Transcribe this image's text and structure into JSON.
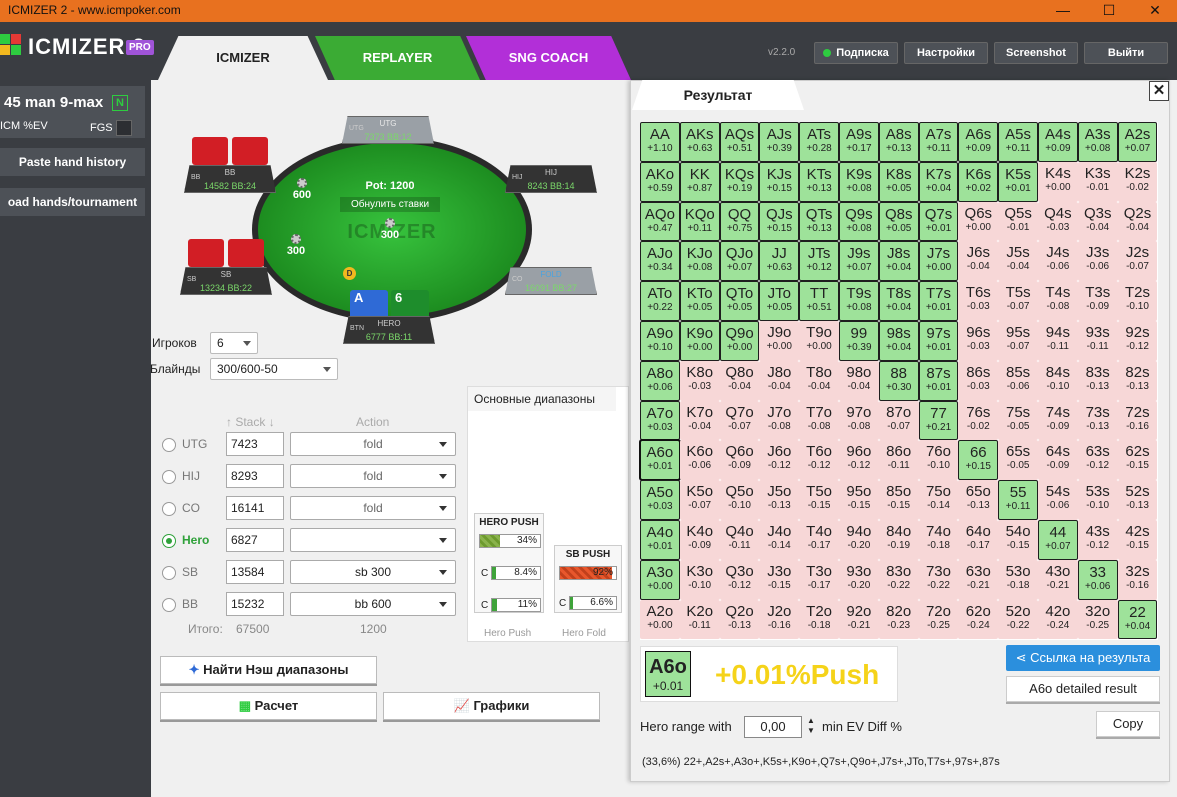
{
  "window": {
    "title": "ICMIZER 2 - www.icmpoker.com",
    "minimize": "—",
    "maximize": "☐",
    "close": "✕"
  },
  "app": {
    "name": "ICMIZER 2",
    "badge": "PRO",
    "version": "v2.2.0"
  },
  "tabs": {
    "icmizer": "ICMIZER",
    "replayer": "REPLAYER",
    "sng": "SNG COACH"
  },
  "top_buttons": {
    "subscription": "Подписка",
    "settings": "Настройки",
    "screenshot": "Screenshot",
    "exit": "Выйти"
  },
  "sidebar": {
    "title": "45 man 9-max",
    "badge": "N",
    "mode": "ICM %EV",
    "fgs": "FGS",
    "paste": "Paste hand history",
    "load": "oad hands/tournament"
  },
  "table": {
    "pot": "Pot: 1200",
    "reset": "Обнулить ставки",
    "watermark": "ICMIZER",
    "dealer": "D",
    "seats": {
      "utg": {
        "pos": "UTG",
        "name": "UTG",
        "stack": "7373 BB:12"
      },
      "hij": {
        "pos": "HIJ",
        "name": "HIJ",
        "stack": "8243 BB:14"
      },
      "co": {
        "pos": "CO",
        "name": "FOLD",
        "stack": "16091 BB:27"
      },
      "bb": {
        "pos": "BB",
        "name": "BB",
        "stack": "14582 BB:24"
      },
      "sb": {
        "pos": "SB",
        "name": "SB",
        "stack": "13234 BB:22"
      },
      "hero": {
        "pos": "BTN",
        "name": "HERO",
        "stack": "6777 BB:11"
      }
    },
    "chips": {
      "bb": "600",
      "sb": "300",
      "btn": "300"
    },
    "hero_cards": [
      "A",
      "6"
    ]
  },
  "settings": {
    "players_label": "Игроков",
    "players": "6",
    "blinds_label": "Блайнды",
    "blinds": "300/600-50"
  },
  "columns": {
    "stack": "Stack",
    "action": "Action"
  },
  "rows": [
    {
      "name": "UTG",
      "stack": "7423",
      "action": "fold"
    },
    {
      "name": "HIJ",
      "stack": "8293",
      "action": "fold"
    },
    {
      "name": "CO",
      "stack": "16141",
      "action": "fold"
    },
    {
      "name": "Hero",
      "stack": "6827",
      "action": ""
    },
    {
      "name": "SB",
      "stack": "13584",
      "action": "sb 300"
    },
    {
      "name": "BB",
      "stack": "15232",
      "action": "bb 600"
    }
  ],
  "totals": {
    "label": "Итого:",
    "stack": "67500",
    "action": "1200"
  },
  "ranges_panel": {
    "tab": "Основные диапазоны",
    "hero_push": {
      "title": "HERO PUSH",
      "pct": "34%",
      "fill": 0.34,
      "c1_label": "C",
      "c1": "8.4%",
      "c1_fill": 0.084,
      "c2_label": "C",
      "c2": "11%",
      "c2_fill": 0.11,
      "footer": "Hero Push"
    },
    "sb_push": {
      "title": "SB PUSH",
      "pct": "92%",
      "fill": 0.92,
      "c1_label": "C",
      "c1": "6.6%",
      "c1_fill": 0.066,
      "footer": "Hero Fold"
    }
  },
  "buttons": {
    "nash": "Найти Нэш диапазоны",
    "calc": "Расчет",
    "graphs": "Графики"
  },
  "result": {
    "tab": "Результат",
    "close": "✕",
    "selected": {
      "hand": "A6o",
      "ev": "+0.01",
      "big": "+0.01%Push"
    },
    "link_button": "Ссылка на результа",
    "detailed_button": "A6o detailed result",
    "copy_button": "Copy",
    "hero_range_label": "Hero range with",
    "hero_range_value": "0,00",
    "hero_range_tail": "min EV Diff %",
    "range_string": "(33,6%) 22+,A2s+,A3o+,K5s+,K9o+,Q7s+,Q9o+,J7s+,JTo,T7s+,97s+,87s"
  },
  "matrix": [
    [
      [
        "AA",
        "+1.10",
        1
      ],
      [
        "AKs",
        "+0.63",
        1
      ],
      [
        "AQs",
        "+0.51",
        1
      ],
      [
        "AJs",
        "+0.39",
        1
      ],
      [
        "ATs",
        "+0.28",
        1
      ],
      [
        "A9s",
        "+0.17",
        1
      ],
      [
        "A8s",
        "+0.13",
        1
      ],
      [
        "A7s",
        "+0.11",
        1
      ],
      [
        "A6s",
        "+0.09",
        1
      ],
      [
        "A5s",
        "+0.11",
        1
      ],
      [
        "A4s",
        "+0.09",
        1
      ],
      [
        "A3s",
        "+0.08",
        1
      ],
      [
        "A2s",
        "+0.07",
        1
      ]
    ],
    [
      [
        "AKo",
        "+0.59",
        1
      ],
      [
        "KK",
        "+0.87",
        1
      ],
      [
        "KQs",
        "+0.19",
        1
      ],
      [
        "KJs",
        "+0.15",
        1
      ],
      [
        "KTs",
        "+0.13",
        1
      ],
      [
        "K9s",
        "+0.08",
        1
      ],
      [
        "K8s",
        "+0.05",
        1
      ],
      [
        "K7s",
        "+0.04",
        1
      ],
      [
        "K6s",
        "+0.02",
        1
      ],
      [
        "K5s",
        "+0.01",
        1
      ],
      [
        "K4s",
        "+0.00",
        0
      ],
      [
        "K3s",
        "-0.01",
        0
      ],
      [
        "K2s",
        "-0.02",
        0
      ]
    ],
    [
      [
        "AQo",
        "+0.47",
        1
      ],
      [
        "KQo",
        "+0.11",
        1
      ],
      [
        "QQ",
        "+0.75",
        1
      ],
      [
        "QJs",
        "+0.15",
        1
      ],
      [
        "QTs",
        "+0.13",
        1
      ],
      [
        "Q9s",
        "+0.08",
        1
      ],
      [
        "Q8s",
        "+0.05",
        1
      ],
      [
        "Q7s",
        "+0.01",
        1
      ],
      [
        "Q6s",
        "+0.00",
        0
      ],
      [
        "Q5s",
        "-0.01",
        0
      ],
      [
        "Q4s",
        "-0.03",
        0
      ],
      [
        "Q3s",
        "-0.04",
        0
      ],
      [
        "Q2s",
        "-0.04",
        0
      ]
    ],
    [
      [
        "AJo",
        "+0.34",
        1
      ],
      [
        "KJo",
        "+0.08",
        1
      ],
      [
        "QJo",
        "+0.07",
        1
      ],
      [
        "JJ",
        "+0.63",
        1
      ],
      [
        "JTs",
        "+0.12",
        1
      ],
      [
        "J9s",
        "+0.07",
        1
      ],
      [
        "J8s",
        "+0.04",
        1
      ],
      [
        "J7s",
        "+0.00",
        1
      ],
      [
        "J6s",
        "-0.04",
        0
      ],
      [
        "J5s",
        "-0.04",
        0
      ],
      [
        "J4s",
        "-0.06",
        0
      ],
      [
        "J3s",
        "-0.06",
        0
      ],
      [
        "J2s",
        "-0.07",
        0
      ]
    ],
    [
      [
        "ATo",
        "+0.22",
        1
      ],
      [
        "KTo",
        "+0.05",
        1
      ],
      [
        "QTo",
        "+0.05",
        1
      ],
      [
        "JTo",
        "+0.05",
        1
      ],
      [
        "TT",
        "+0.51",
        1
      ],
      [
        "T9s",
        "+0.08",
        1
      ],
      [
        "T8s",
        "+0.04",
        1
      ],
      [
        "T7s",
        "+0.01",
        1
      ],
      [
        "T6s",
        "-0.03",
        0
      ],
      [
        "T5s",
        "-0.07",
        0
      ],
      [
        "T4s",
        "-0.08",
        0
      ],
      [
        "T3s",
        "-0.09",
        0
      ],
      [
        "T2s",
        "-0.10",
        0
      ]
    ],
    [
      [
        "A9o",
        "+0.10",
        1
      ],
      [
        "K9o",
        "+0.00",
        1
      ],
      [
        "Q9o",
        "+0.00",
        1
      ],
      [
        "J9o",
        "+0.00",
        0
      ],
      [
        "T9o",
        "+0.00",
        0
      ],
      [
        "99",
        "+0.39",
        1
      ],
      [
        "98s",
        "+0.04",
        1
      ],
      [
        "97s",
        "+0.01",
        1
      ],
      [
        "96s",
        "-0.03",
        0
      ],
      [
        "95s",
        "-0.07",
        0
      ],
      [
        "94s",
        "-0.11",
        0
      ],
      [
        "93s",
        "-0.11",
        0
      ],
      [
        "92s",
        "-0.12",
        0
      ]
    ],
    [
      [
        "A8o",
        "+0.06",
        1
      ],
      [
        "K8o",
        "-0.03",
        0
      ],
      [
        "Q8o",
        "-0.04",
        0
      ],
      [
        "J8o",
        "-0.04",
        0
      ],
      [
        "T8o",
        "-0.04",
        0
      ],
      [
        "98o",
        "-0.04",
        0
      ],
      [
        "88",
        "+0.30",
        1
      ],
      [
        "87s",
        "+0.01",
        1
      ],
      [
        "86s",
        "-0.03",
        0
      ],
      [
        "85s",
        "-0.06",
        0
      ],
      [
        "84s",
        "-0.10",
        0
      ],
      [
        "83s",
        "-0.13",
        0
      ],
      [
        "82s",
        "-0.13",
        0
      ]
    ],
    [
      [
        "A7o",
        "+0.03",
        1
      ],
      [
        "K7o",
        "-0.04",
        0
      ],
      [
        "Q7o",
        "-0.07",
        0
      ],
      [
        "J7o",
        "-0.08",
        0
      ],
      [
        "T7o",
        "-0.08",
        0
      ],
      [
        "97o",
        "-0.08",
        0
      ],
      [
        "87o",
        "-0.07",
        0
      ],
      [
        "77",
        "+0.21",
        1
      ],
      [
        "76s",
        "-0.02",
        0
      ],
      [
        "75s",
        "-0.05",
        0
      ],
      [
        "74s",
        "-0.09",
        0
      ],
      [
        "73s",
        "-0.13",
        0
      ],
      [
        "72s",
        "-0.16",
        0
      ]
    ],
    [
      [
        "A6o",
        "+0.01",
        2
      ],
      [
        "K6o",
        "-0.06",
        0
      ],
      [
        "Q6o",
        "-0.09",
        0
      ],
      [
        "J6o",
        "-0.12",
        0
      ],
      [
        "T6o",
        "-0.12",
        0
      ],
      [
        "96o",
        "-0.12",
        0
      ],
      [
        "86o",
        "-0.11",
        0
      ],
      [
        "76o",
        "-0.10",
        0
      ],
      [
        "66",
        "+0.15",
        1
      ],
      [
        "65s",
        "-0.05",
        0
      ],
      [
        "64s",
        "-0.09",
        0
      ],
      [
        "63s",
        "-0.12",
        0
      ],
      [
        "62s",
        "-0.15",
        0
      ]
    ],
    [
      [
        "A5o",
        "+0.03",
        1
      ],
      [
        "K5o",
        "-0.07",
        0
      ],
      [
        "Q5o",
        "-0.10",
        0
      ],
      [
        "J5o",
        "-0.13",
        0
      ],
      [
        "T5o",
        "-0.15",
        0
      ],
      [
        "95o",
        "-0.15",
        0
      ],
      [
        "85o",
        "-0.15",
        0
      ],
      [
        "75o",
        "-0.14",
        0
      ],
      [
        "65o",
        "-0.13",
        0
      ],
      [
        "55",
        "+0.11",
        1
      ],
      [
        "54s",
        "-0.06",
        0
      ],
      [
        "53s",
        "-0.10",
        0
      ],
      [
        "52s",
        "-0.13",
        0
      ]
    ],
    [
      [
        "A4o",
        "+0.01",
        1
      ],
      [
        "K4o",
        "-0.09",
        0
      ],
      [
        "Q4o",
        "-0.11",
        0
      ],
      [
        "J4o",
        "-0.14",
        0
      ],
      [
        "T4o",
        "-0.17",
        0
      ],
      [
        "94o",
        "-0.20",
        0
      ],
      [
        "84o",
        "-0.19",
        0
      ],
      [
        "74o",
        "-0.18",
        0
      ],
      [
        "64o",
        "-0.17",
        0
      ],
      [
        "54o",
        "-0.15",
        0
      ],
      [
        "44",
        "+0.07",
        1
      ],
      [
        "43s",
        "-0.12",
        0
      ],
      [
        "42s",
        "-0.15",
        0
      ]
    ],
    [
      [
        "A3o",
        "+0.00",
        1
      ],
      [
        "K3o",
        "-0.10",
        0
      ],
      [
        "Q3o",
        "-0.12",
        0
      ],
      [
        "J3o",
        "-0.15",
        0
      ],
      [
        "T3o",
        "-0.17",
        0
      ],
      [
        "93o",
        "-0.20",
        0
      ],
      [
        "83o",
        "-0.22",
        0
      ],
      [
        "73o",
        "-0.22",
        0
      ],
      [
        "63o",
        "-0.21",
        0
      ],
      [
        "53o",
        "-0.18",
        0
      ],
      [
        "43o",
        "-0.21",
        0
      ],
      [
        "33",
        "+0.06",
        1
      ],
      [
        "32s",
        "-0.16",
        0
      ]
    ],
    [
      [
        "A2o",
        "+0.00",
        0
      ],
      [
        "K2o",
        "-0.11",
        0
      ],
      [
        "Q2o",
        "-0.13",
        0
      ],
      [
        "J2o",
        "-0.16",
        0
      ],
      [
        "T2o",
        "-0.18",
        0
      ],
      [
        "92o",
        "-0.21",
        0
      ],
      [
        "82o",
        "-0.23",
        0
      ],
      [
        "72o",
        "-0.25",
        0
      ],
      [
        "62o",
        "-0.24",
        0
      ],
      [
        "52o",
        "-0.22",
        0
      ],
      [
        "42o",
        "-0.24",
        0
      ],
      [
        "32o",
        "-0.25",
        0
      ],
      [
        "22",
        "+0.04",
        1
      ]
    ]
  ],
  "colors": {
    "push": "#9ee29a",
    "fold": "#f7d7d7",
    "accent": "#2fa13a",
    "link": "#2b8fdd"
  }
}
